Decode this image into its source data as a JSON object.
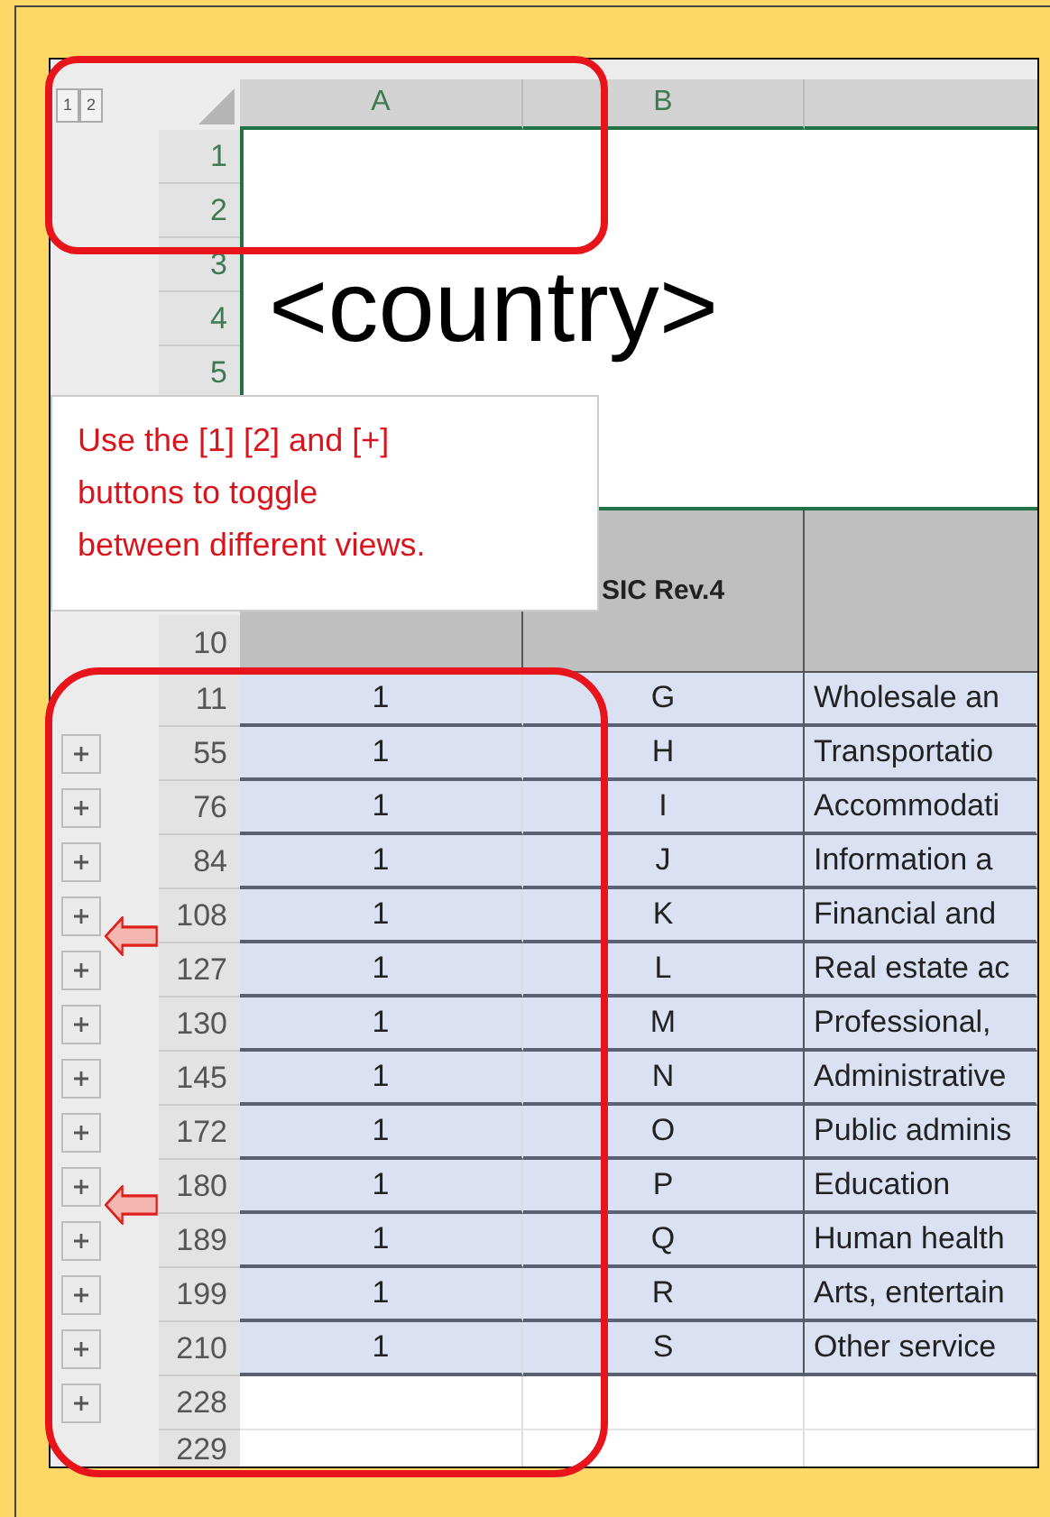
{
  "outline_level_buttons": [
    "1",
    "2"
  ],
  "column_headers": [
    "A",
    "B"
  ],
  "title_row_numbers": [
    "1",
    "2",
    "3",
    "4",
    "5"
  ],
  "title": "<country>",
  "header": {
    "row_number": "10",
    "column_b": "SIC Rev.4"
  },
  "rows": [
    {
      "row_number": "11",
      "expandable": false,
      "filled": true,
      "column_a": "1",
      "column_b": "G",
      "column_c": "Wholesale an"
    },
    {
      "row_number": "55",
      "expandable": true,
      "filled": true,
      "column_a": "1",
      "column_b": "H",
      "column_c": "Transportatio"
    },
    {
      "row_number": "76",
      "expandable": true,
      "filled": true,
      "column_a": "1",
      "column_b": "I",
      "column_c": "Accommodati"
    },
    {
      "row_number": "84",
      "expandable": true,
      "filled": true,
      "column_a": "1",
      "column_b": "J",
      "column_c": "Information a"
    },
    {
      "row_number": "108",
      "expandable": true,
      "filled": true,
      "column_a": "1",
      "column_b": "K",
      "column_c": "Financial and"
    },
    {
      "row_number": "127",
      "expandable": true,
      "filled": true,
      "column_a": "1",
      "column_b": "L",
      "column_c": "Real estate ac"
    },
    {
      "row_number": "130",
      "expandable": true,
      "filled": true,
      "column_a": "1",
      "column_b": "M",
      "column_c": "Professional,"
    },
    {
      "row_number": "145",
      "expandable": true,
      "filled": true,
      "column_a": "1",
      "column_b": "N",
      "column_c": "Administrative"
    },
    {
      "row_number": "172",
      "expandable": true,
      "filled": true,
      "column_a": "1",
      "column_b": "O",
      "column_c": "Public adminis"
    },
    {
      "row_number": "180",
      "expandable": true,
      "filled": true,
      "column_a": "1",
      "column_b": "P",
      "column_c": "Education"
    },
    {
      "row_number": "189",
      "expandable": true,
      "filled": true,
      "column_a": "1",
      "column_b": "Q",
      "column_c": "Human health"
    },
    {
      "row_number": "199",
      "expandable": true,
      "filled": true,
      "column_a": "1",
      "column_b": "R",
      "column_c": "Arts, entertain"
    },
    {
      "row_number": "210",
      "expandable": true,
      "filled": true,
      "column_a": "1",
      "column_b": "S",
      "column_c": "Other service"
    },
    {
      "row_number": "228",
      "expandable": true,
      "filled": false
    },
    {
      "row_number": "229",
      "expandable": false,
      "filled": false
    }
  ],
  "callout": "Use the [1] [2] and [+] buttons to toggle between different views."
}
